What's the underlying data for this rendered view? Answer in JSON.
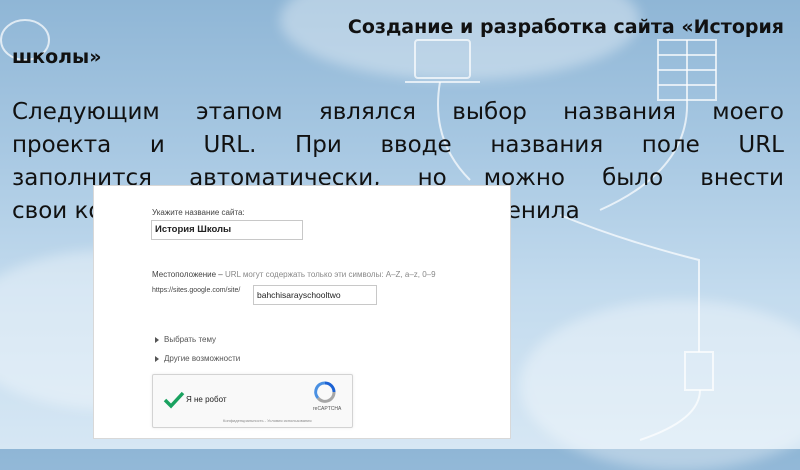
{
  "slide": {
    "title_line1": "Создание и разработка сайта «История",
    "title_line2": "школы»",
    "body_line1": "Следующим этапом являлся выбор названия моего",
    "body_line2": "проекта и URL. При вводе названия поле URL",
    "body_line3": "заполнится автоматически, но можно было внести",
    "body_line4": "свои коррективы, что я и сделала, я изменила"
  },
  "form": {
    "site_name_label": "Укажите название сайта:",
    "site_name_value": "История Школы",
    "location_label": "Местоположение –",
    "location_hint": "URL могут содержать только эти символы: A–Z, a–z, 0–9",
    "url_prefix": "https://sites.google.com/site/",
    "url_value": "bahchisarayschooltwo",
    "choose_theme": "Выбрать тему",
    "more_options": "Другие возможности"
  },
  "captcha": {
    "label": "Я не робот",
    "brand": "reCAPTCHA",
    "fine_print": "Конфиденциальность - Условия использования"
  },
  "colors": {
    "check": "#1aa260",
    "recaptcha_blue": "#1c62d4",
    "recaptcha_gray": "#a6a6a6"
  }
}
